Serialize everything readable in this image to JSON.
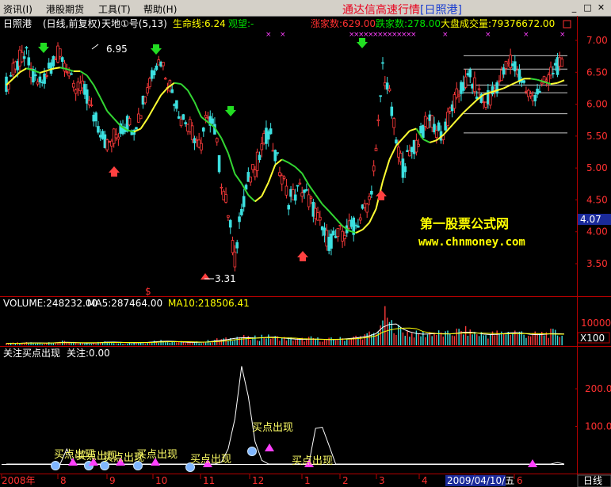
{
  "menu": {
    "items": [
      "资讯(I)",
      "港股期货",
      "工具(T)",
      "帮助(H)"
    ],
    "app_title": "通达信高速行情",
    "symbol_tag": "[日照港]"
  },
  "header": {
    "stock": "日照港",
    "period": "(日线,前复权)",
    "indicator": "天地①号(5,13)",
    "life_line": "生命线:6.24",
    "watch": "观望:-",
    "up_count": "涨家数:629.00",
    "down_count": "跌家数:278.00",
    "market_volume": "大盘成交量:79376672.00"
  },
  "watermark": {
    "line1": "第一股票公式网",
    "line2": "www.chnmoney.com"
  },
  "price_marks": {
    "high": "6.95",
    "low": "3.31",
    "current": "4.07",
    "dollar": "$"
  },
  "volume_panel": {
    "volume": "VOLUME:248232.00",
    "ma5": "MA5:287464.00",
    "ma10": "MA10:218506.41",
    "axis_unit": "X100"
  },
  "indicator_panel": {
    "title": "关注买点出现",
    "value": "关注:0.00",
    "signal_text": "买点出现"
  },
  "bottom": {
    "months": [
      "2008年",
      "8",
      "9",
      "10",
      "11",
      "12",
      "1",
      "2",
      "3",
      "4",
      "5",
      "6"
    ],
    "date_cursor": "2009/04/10/五",
    "tab": "日线"
  },
  "chart_data": [
    {
      "type": "candlestick",
      "title": "",
      "y_ticks": [
        7.0,
        6.5,
        6.0,
        5.5,
        5.0,
        4.5,
        4.0,
        3.5
      ],
      "ylim": [
        3.2,
        7.15
      ],
      "x_months": [
        "2008年",
        "8",
        "9",
        "10",
        "11",
        "12",
        "1",
        "2",
        "3",
        "4",
        "5",
        "6"
      ],
      "annotations": [
        {
          "label": "6.95",
          "value": 6.95
        },
        {
          "label": "3.31",
          "value": 3.31
        }
      ],
      "life_line_value": 6.24,
      "close_series_approx": [
        6.3,
        6.5,
        6.7,
        6.75,
        6.4,
        6.3,
        6.5,
        6.7,
        6.8,
        6.6,
        6.2,
        6.3,
        6.1,
        5.8,
        5.6,
        5.35,
        5.5,
        5.6,
        5.7,
        5.65,
        5.9,
        6.3,
        6.6,
        6.7,
        6.4,
        6.1,
        5.8,
        5.7,
        5.5,
        5.3,
        5.9,
        5.6,
        4.8,
        4.3,
        3.55,
        4.4,
        4.8,
        5.0,
        5.3,
        5.6,
        5.2,
        4.9,
        4.5,
        4.6,
        4.7,
        4.5,
        4.3,
        4.0,
        3.85,
        3.9,
        4.0,
        4.05,
        4.1,
        4.3,
        4.5,
        5.2,
        6.6,
        6.1,
        5.4,
        5.0,
        5.2,
        5.4,
        5.6,
        5.8,
        5.6,
        5.5,
        5.9,
        6.1,
        6.3,
        6.4,
        6.2,
        6.0,
        6.1,
        6.3,
        6.5,
        6.7,
        6.5,
        6.3,
        6.1,
        6.2,
        6.3,
        6.5,
        6.6,
        6.55
      ],
      "reference_lines": [
        6.76,
        6.55,
        6.3,
        6.18,
        5.85,
        5.55
      ]
    },
    {
      "type": "bar",
      "title": "VOLUME",
      "y_ticks": [
        10000
      ],
      "series": [
        {
          "name": "MA5",
          "color": "#ffffff"
        },
        {
          "name": "MA10",
          "color": "#ffff00"
        }
      ],
      "values_approx": [
        800,
        1000,
        900,
        1200,
        1100,
        900,
        1000,
        1300,
        1500,
        1200,
        1100,
        1000,
        900,
        1200,
        1400,
        1600,
        1300,
        1100,
        1000,
        1200,
        1300,
        1400,
        1800,
        2000,
        1700,
        1500,
        1400,
        1200,
        1300,
        1500,
        1800,
        2400,
        2600,
        2900,
        3800,
        3500,
        3000,
        3200,
        4000,
        3600,
        3300,
        3000,
        2800,
        2500,
        2600,
        3000,
        2700,
        2400,
        2600,
        2800,
        3000,
        3300,
        3600,
        4200,
        5000,
        6500,
        12800,
        9000,
        7000,
        6000,
        5200,
        4800,
        5000,
        5600,
        5200,
        4800,
        5400,
        6000,
        6200,
        5500,
        5000,
        4600,
        4900,
        5200,
        5600,
        6000,
        5400,
        4800,
        4600,
        5000,
        5200,
        5400,
        5000,
        4800
      ]
    },
    {
      "type": "line",
      "title": "关注买点出现",
      "y_ticks": [
        200.0,
        100.0
      ],
      "ylim": [
        0,
        270
      ],
      "values_approx": [
        0,
        0,
        0,
        0,
        0,
        0,
        0,
        0,
        0,
        40,
        0,
        0,
        0,
        0,
        0,
        0,
        0,
        0,
        0,
        0,
        0,
        0,
        0,
        0,
        0,
        0,
        0,
        0,
        0,
        0,
        0,
        0,
        5,
        40,
        120,
        260,
        180,
        60,
        10,
        0,
        0,
        0,
        0,
        0,
        0,
        0,
        95,
        98,
        50,
        0,
        0,
        0,
        0,
        0,
        0,
        0,
        0,
        0,
        0,
        0,
        0,
        0,
        0,
        0,
        0,
        0,
        0,
        0,
        0,
        0,
        0,
        0,
        0,
        0,
        0,
        0,
        0,
        0,
        0,
        0,
        0,
        0,
        4,
        0
      ]
    }
  ]
}
